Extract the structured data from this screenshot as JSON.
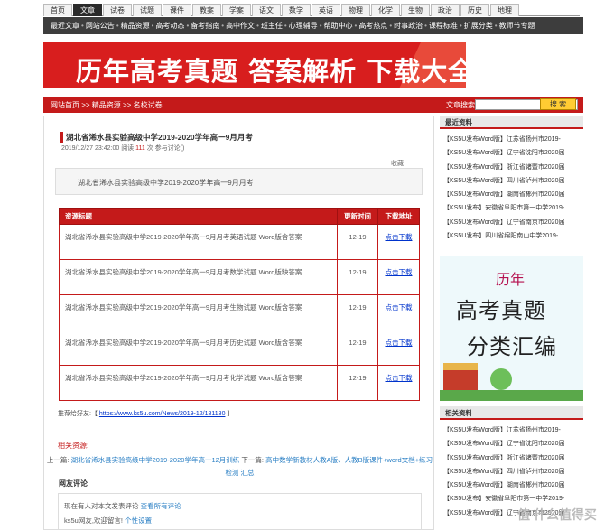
{
  "topnav": [
    {
      "label": "首页",
      "active": false
    },
    {
      "label": "文章",
      "active": true
    },
    {
      "label": "试卷",
      "active": false
    },
    {
      "label": "试题",
      "active": false
    },
    {
      "label": "课件",
      "active": false
    },
    {
      "label": "教案",
      "active": false
    },
    {
      "label": "学案",
      "active": false
    },
    {
      "label": "语文",
      "active": false
    },
    {
      "label": "数学",
      "active": false
    },
    {
      "label": "英语",
      "active": false
    },
    {
      "label": "物理",
      "active": false
    },
    {
      "label": "化学",
      "active": false
    },
    {
      "label": "生物",
      "active": false
    },
    {
      "label": "政治",
      "active": false
    },
    {
      "label": "历史",
      "active": false
    },
    {
      "label": "地理",
      "active": false
    }
  ],
  "subnav": [
    "最近文章",
    "网站公告",
    "精品资源",
    "高考动态",
    "备考指南",
    "高中作文",
    "班主任",
    "心理辅导",
    "帮助中心",
    "高考热点",
    "时事政治",
    "课程标准",
    "扩展分类",
    "教师节专题"
  ],
  "banner": {
    "text": "历年高考真题 答案解析 下载大全"
  },
  "crumb": "网站首页 >> 精品资源 >> 名校试卷",
  "search": {
    "label": "文章搜索:",
    "value": "",
    "button": "搜 索"
  },
  "article": {
    "title": "湖北省浠水县实验高级中学2019-2020学年高一9月月考",
    "meta_date": "2019/12/27 23:42:00",
    "meta_read_label": "阅读",
    "meta_read_count": "111",
    "meta_suffix": "次 参与讨论()",
    "fav": "收藏",
    "summary": "湖北省浠水县实验高级中学2019-2020学年高一9月月考"
  },
  "table": {
    "headers": [
      "资源标题",
      "更新时间",
      "下载地址"
    ],
    "rows": [
      {
        "title": "湖北省浠水县实验高级中学2019-2020学年高一9月月考英语试题 Word版含答案",
        "date": "12-19",
        "link": "点击下载"
      },
      {
        "title": "湖北省浠水县实验高级中学2019-2020学年高一9月月考数学试题 Word版缺答案",
        "date": "12-19",
        "link": "点击下载"
      },
      {
        "title": "湖北省浠水县实验高级中学2019-2020学年高一9月月考生物试题 Word版含答案",
        "date": "12-19",
        "link": "点击下载"
      },
      {
        "title": "湖北省浠水县实验高级中学2019-2020学年高一9月月考历史试题 Word版含答案",
        "date": "12-19",
        "link": "点击下载"
      },
      {
        "title": "湖北省浠水县实验高级中学2019-2020学年高一9月月考化学试题 Word版含答案",
        "date": "12-19",
        "link": "点击下载"
      }
    ]
  },
  "recommend": {
    "label": "推荐给好友:【",
    "url": "https://www.ks5u.com/News/2019-12/181180",
    "end": "】"
  },
  "related": "相关资源:",
  "prevnext": {
    "prev_label": "上一篇:",
    "prev": "湖北省浠水县实验高级中学2019-2020学年高一12月训练",
    "next_label": "下一篇:",
    "next": "高中数学新教材人教A版、人教B版课件+word文档+练习检测 汇总"
  },
  "comments": {
    "title": "网友评论",
    "line1a": "现在有人对本文发表评论",
    "line1b": "查看所有评论",
    "line2a": "ks5u网友,欢迎留言!",
    "line2b": "个性设置"
  },
  "side": {
    "recent_title": "最近资料",
    "recent": [
      "【KS5U发布Word版】江苏省扬州市2019-",
      "【KS5U发布Word版】辽宁省沈阳市2020届",
      "【KS5U发布Word版】浙江省诸暨市2020届",
      "【KS5U发布Word版】四川省泸州市2020届",
      "【KS5U发布Word版】湖南省郴州市2020届",
      "【KS5U发布】安徽省阜阳市第一中学2019-",
      "【KS5U发布Word版】辽宁省南京市2020届",
      "【KS5U发布】四川省绵阳南山中学2019-"
    ],
    "ad": {
      "t1": "历年",
      "t2": "高考真题",
      "t3": "分类汇编"
    },
    "related_title": "相关资料",
    "related": [
      "【KS5U发布Word版】江苏省扬州市2019-",
      "【KS5U发布Word版】辽宁省沈阳市2020届",
      "【KS5U发布Word版】浙江省诸暨市2020届",
      "【KS5U发布Word版】四川省泸州市2020届",
      "【KS5U发布Word版】湖南省郴州市2020届",
      "【KS5U发布】安徽省阜阳市第一中学2019-",
      "【KS5U发布Word版】辽宁省南京市2020届"
    ]
  },
  "watermark": "值 什么值得买"
}
